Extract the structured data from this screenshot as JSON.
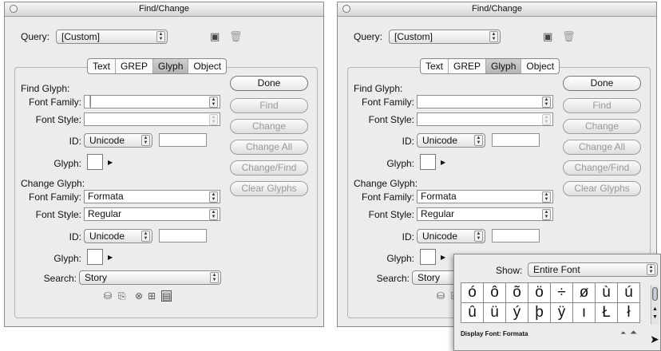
{
  "dialog": {
    "title": "Find/Change",
    "query_label": "Query:",
    "query_value": "[Custom]",
    "tabs": [
      "Text",
      "GREP",
      "Glyph",
      "Object"
    ],
    "selected_tab": "Glyph",
    "find_section": "Find Glyph:",
    "change_section": "Change Glyph:",
    "font_family_label": "Font Family:",
    "font_style_label": "Font Style:",
    "id_label": "ID:",
    "glyph_label": "Glyph:",
    "search_label": "Search:",
    "find_font_family": "",
    "find_font_style": "",
    "find_id_type": "Unicode",
    "find_id_value": "",
    "change_font_family": "Formata",
    "change_font_style": "Regular",
    "change_id_type": "Unicode",
    "change_id_value": "",
    "search_value": "Story",
    "buttons": [
      "Done",
      "Find",
      "Change",
      "Change All",
      "Change/Find",
      "Clear Glyphs"
    ],
    "icons": [
      "save-query-icon",
      "delete-query-icon",
      "include-locked-layers-icon",
      "include-locked-stories-icon",
      "include-hidden-layers-icon",
      "include-master-pages-icon",
      "include-footnotes-icon"
    ]
  },
  "palette": {
    "show_label": "Show:",
    "show_value": "Entire Font",
    "glyphs_row1": [
      "ó",
      "ô",
      "õ",
      "ö",
      "÷",
      "ø",
      "ù",
      "ú"
    ],
    "glyphs_row2": [
      "û",
      "ü",
      "ý",
      "þ",
      "ÿ",
      "ı",
      "Ł",
      "ł"
    ],
    "display_font_label": "Display Font: Formata"
  }
}
